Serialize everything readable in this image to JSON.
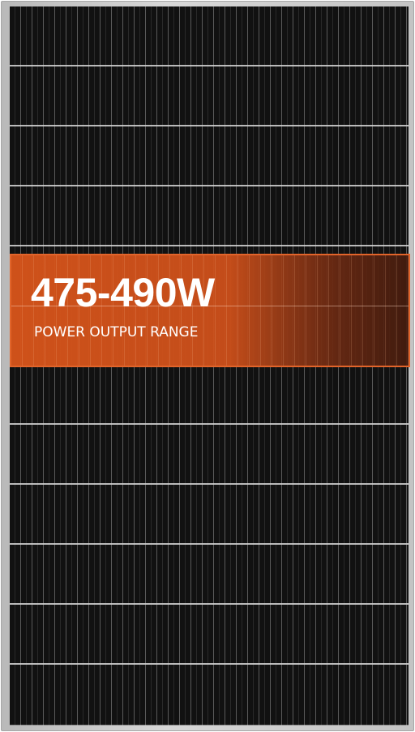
{
  "banner": {
    "title": "475-490W",
    "subtitle": "POWER OUTPUT RANGE"
  },
  "colors": {
    "banner_orange": "#d6541a",
    "cell_black": "#111111",
    "frame_silver": "#c4c4c4"
  }
}
